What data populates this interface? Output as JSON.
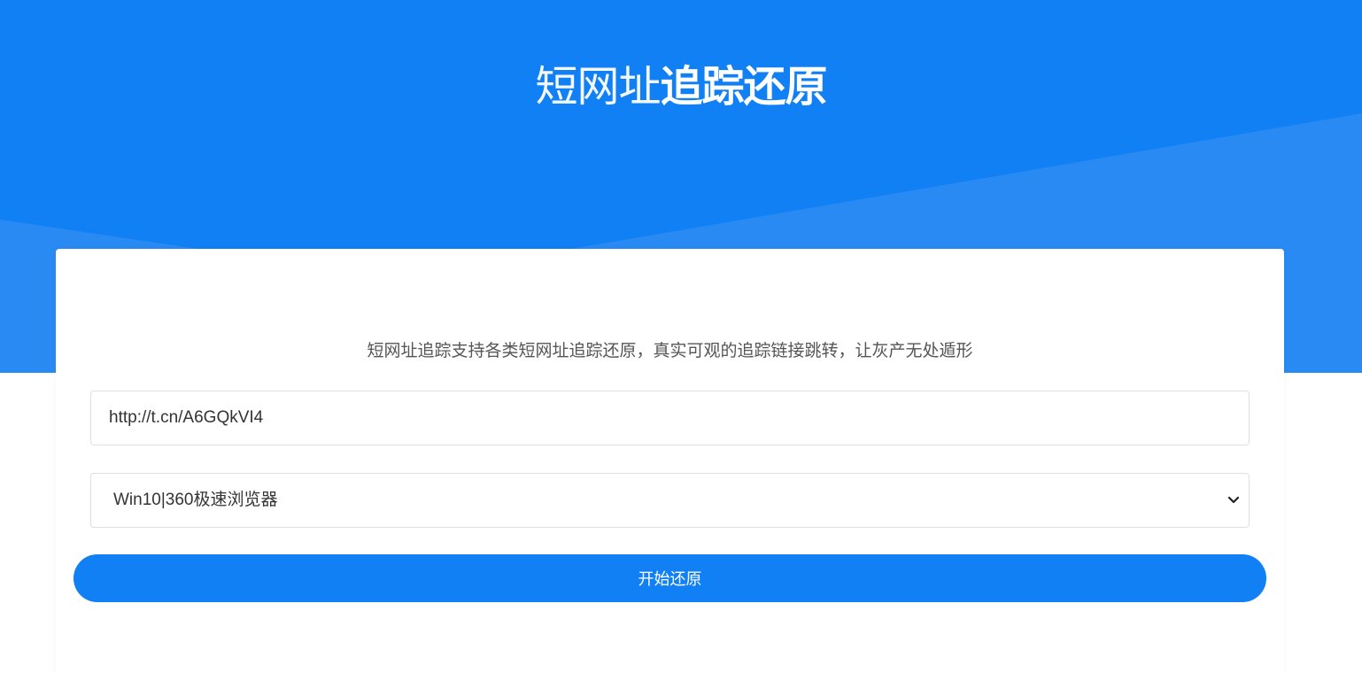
{
  "header": {
    "title_light": "短网址",
    "title_bold": "追踪还原"
  },
  "main": {
    "tagline": "短网址追踪支持各类短网址追踪还原，真实可观的追踪链接跳转，让灰产无处遁形",
    "url_input": {
      "value": "http://t.cn/A6GQkVI4"
    },
    "browser_select": {
      "selected": "Win10|360极速浏览器"
    },
    "submit_label": "开始还原"
  },
  "colors": {
    "primary": "#1180f4",
    "hero_shape": "#2a8af3",
    "card_bg": "#ffffff",
    "text": "#555555"
  },
  "icons": {
    "select_arrow": "chevron-down-icon"
  }
}
